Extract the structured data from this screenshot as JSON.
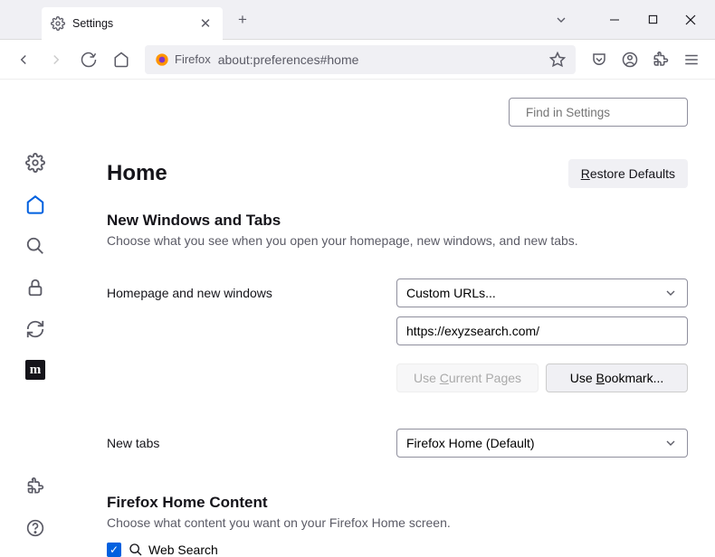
{
  "tab": {
    "title": "Settings"
  },
  "url": {
    "identity": "Firefox",
    "address": "about:preferences#home"
  },
  "search": {
    "placeholder": "Find in Settings"
  },
  "page": {
    "title": "Home",
    "restore": "Restore Defaults",
    "section1_title": "New Windows and Tabs",
    "section1_sub": "Choose what you see when you open your homepage, new windows, and new tabs.",
    "homepage_label": "Homepage and new windows",
    "homepage_select": "Custom URLs...",
    "homepage_url": "https://exyzsearch.com/",
    "use_current": "Use Current Pages",
    "use_bookmark": "Use Bookmark...",
    "newtabs_label": "New tabs",
    "newtabs_select": "Firefox Home (Default)",
    "section2_title": "Firefox Home Content",
    "section2_sub": "Choose what content you want on your Firefox Home screen.",
    "websearch": "Web Search"
  }
}
